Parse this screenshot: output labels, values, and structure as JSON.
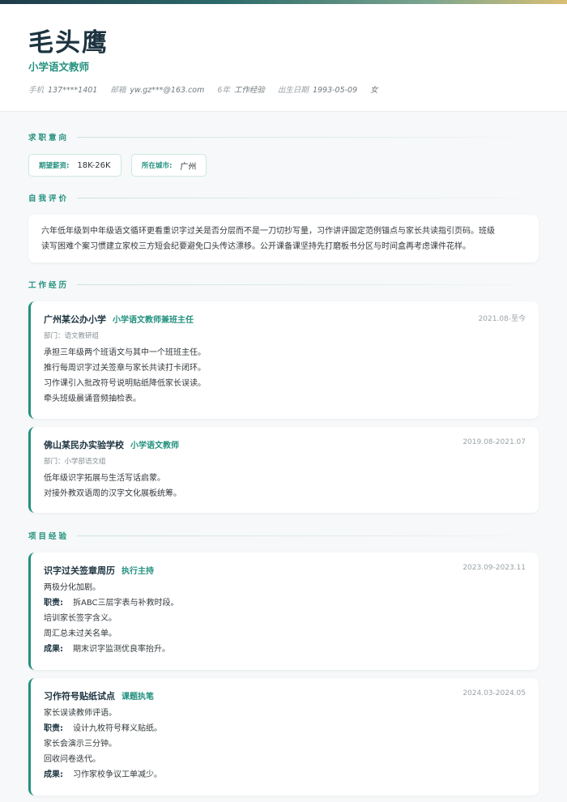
{
  "header": {
    "name": "毛头鹰",
    "title": "小学语文教师",
    "phone_label": "手机",
    "phone": "137****1401",
    "email_label": "邮箱",
    "email": "yw.gz***@163.com",
    "exp_label": "6年",
    "exp": "工作经验",
    "birth_label": "出生日期",
    "birth": "1993-05-09",
    "gender": "女"
  },
  "intent": {
    "section_title": "求职意向",
    "salary_label": "期望薪资:",
    "salary": "18K-26K",
    "city_label": "所在城市:",
    "city": "广州"
  },
  "summary": {
    "section_title": "自我评价",
    "line1": "六年低年级到中年级语文循环更看重识字过关是否分层而不是一刀切抄写量，习作讲评固定范例锚点与家长共读指引页码。班级",
    "line2": "读写困难个案习惯建立家校三方短会纪要避免口头传达漂移。公开课备课坚持先打磨板书分区与时间盒再考虑课件花样。"
  },
  "work": {
    "section_title": "工作经历",
    "items": [
      {
        "org": "广州某公办小学",
        "role": "小学语文教师兼班主任",
        "date": "2021.08-至今",
        "dept": "部门：语文教研组",
        "lines": [
          "承担三年级两个班语文与其中一个班班主任。",
          "推行每周识字过关签章与家长共读打卡闭环。",
          "习作课引入批改符号说明贴纸降低家长误读。",
          "牵头班级晨诵音频抽检表。"
        ]
      },
      {
        "org": "佛山某民办实验学校",
        "role": "小学语文教师",
        "date": "2019.08-2021.07",
        "dept": "部门：小学部语文组",
        "lines": [
          "低年级识字拓展与生活写话启蒙。",
          "对接外教双语周的汉字文化展板统筹。"
        ]
      }
    ]
  },
  "projects": {
    "section_title": "项目经验",
    "items": [
      {
        "name": "识字过关签章周历",
        "role": "执行主持",
        "date": "2023.09-2023.11",
        "intro": "两极分化加剧。",
        "duty_label": "职责:",
        "duty1": "拆ABC三层字表与补救时段。",
        "duty2": "培训家长签字含义。",
        "duty3": "周汇总未过关名单。",
        "result_label": "成果:",
        "result": "期末识字监测优良率抬升。"
      },
      {
        "name": "习作符号贴纸试点",
        "role": "课题执笔",
        "date": "2024.03-2024.05",
        "intro": "家长误读教师评语。",
        "duty_label": "职责:",
        "duty1": "设计九枚符号释义贴纸。",
        "duty2": "家长会演示三分钟。",
        "duty3": "回收问卷迭代。",
        "result_label": "成果:",
        "result": "习作家校争议工单减少。"
      }
    ]
  }
}
